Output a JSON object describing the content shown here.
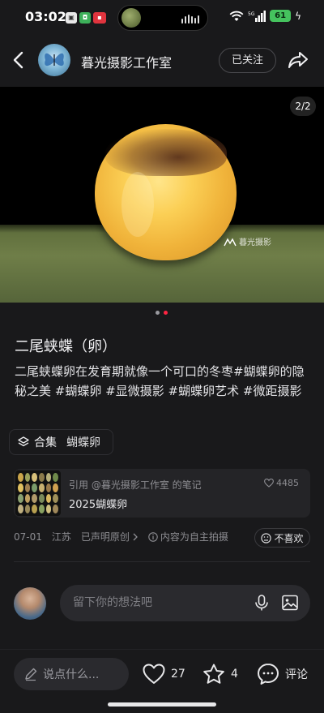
{
  "status_bar": {
    "time": "03:02",
    "battery": "61",
    "signal": "5G"
  },
  "header": {
    "author_name": "暮光摄影工作室",
    "follow_label": "已关注"
  },
  "photo": {
    "page_indicator": "2/2",
    "watermark": "暮光摄影"
  },
  "post": {
    "title": "二尾蛱蝶（卵）",
    "body": "二尾蛱蝶卵在发育期就像一个可口的冬枣",
    "tags": [
      "#蝴蝶卵的隐秘之美",
      "#蝴蝶卵",
      "#显微摄影",
      "#蝴蝶卵艺术",
      "#微距摄影"
    ],
    "collection_label": "合集",
    "collection_name": "蝴蝶卵"
  },
  "reference": {
    "caption": "引用 @暮光摄影工作室 的笔记",
    "title": "2025蝴蝶卵",
    "likes": "4485"
  },
  "meta": {
    "date": "07-01",
    "location": "江苏",
    "original": "已声明原创",
    "self_shot": "内容为自主拍摄",
    "dislike_label": "不喜欢"
  },
  "comment": {
    "placeholder": "留下你的想法吧"
  },
  "bottom_bar": {
    "say_placeholder": "说点什么...",
    "likes": "27",
    "collects": "4",
    "comment_label": "评论"
  },
  "colors": {
    "background": "#19191b",
    "active_dot": "#ff2442",
    "inactive_dot": "#9a9aa0"
  }
}
